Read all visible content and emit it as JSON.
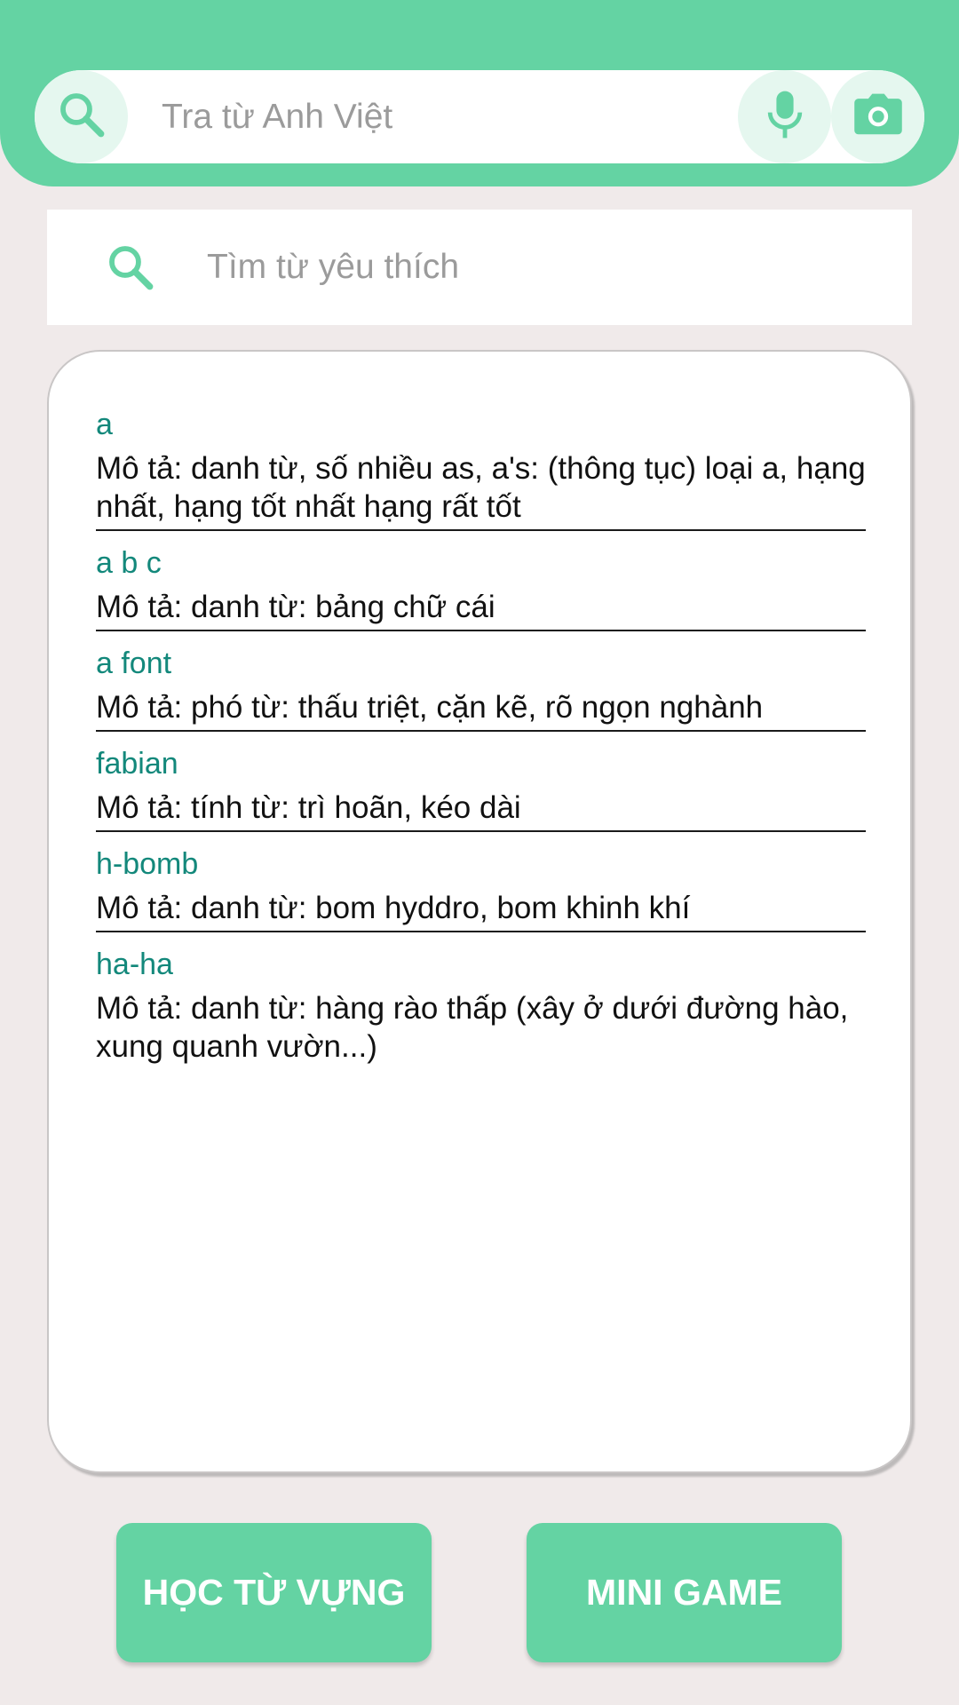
{
  "header": {
    "search_placeholder": "Tra từ Anh Việt",
    "search_value": "",
    "icons": [
      "search-icon",
      "microphone-icon",
      "camera-icon"
    ],
    "accent_color": "#64d3a3"
  },
  "favorites": {
    "search_placeholder": "Tìm từ yêu thích",
    "search_value": "",
    "icon": "search-icon"
  },
  "entries": [
    {
      "word": "a",
      "desc": "Mô tả: danh từ,  số nhiều as,  a's: (thông tục) loại a, hạng nhất, hạng tốt nhất hạng rất tốt"
    },
    {
      "word": "a b c",
      "desc": "Mô tả: danh từ: bảng chữ cái"
    },
    {
      "word": "a font",
      "desc": "Mô tả: phó từ: thấu triệt, cặn kẽ, rõ ngọn nghành"
    },
    {
      "word": "fabian",
      "desc": "Mô tả: tính từ: trì hoãn, kéo dài"
    },
    {
      "word": "h-bomb",
      "desc": "Mô tả: danh từ: bom hyddro, bom khinh khí"
    },
    {
      "word": "ha-ha",
      "desc": "Mô tả: danh từ: hàng rào thấp (xây ở dưới đường hào, xung quanh vườn...)"
    }
  ],
  "buttons": {
    "vocab_label": "HỌC TỪ VỰNG",
    "game_label": "MINI GAME"
  }
}
